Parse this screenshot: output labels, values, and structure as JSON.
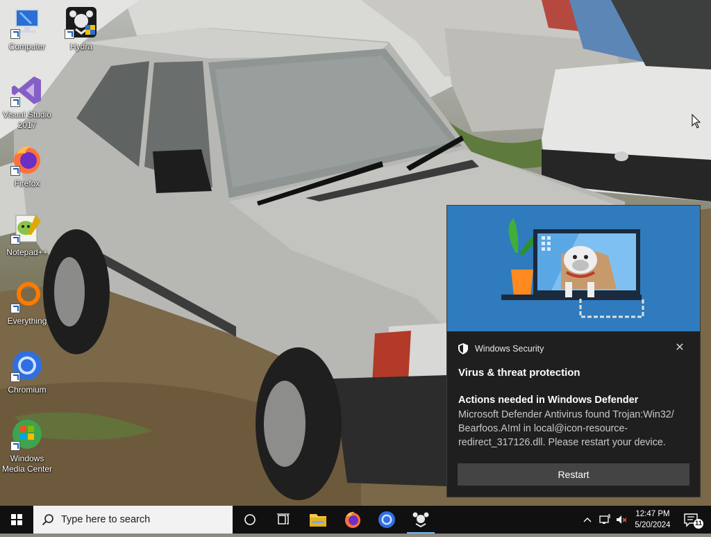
{
  "desktop": {
    "icons": [
      {
        "label": "Computer"
      },
      {
        "label": "Hydra"
      },
      {
        "label": "Visual Studio 2017"
      },
      {
        "label": "Firefox"
      },
      {
        "label": "Notepad++"
      },
      {
        "label": "Everything"
      },
      {
        "label": "Chromium"
      },
      {
        "label": "Windows Media Center"
      }
    ]
  },
  "toast": {
    "app_name": "Windows Security",
    "title": "Virus & threat protection",
    "subtitle": "Actions needed in Windows Defender",
    "body": "Microsoft Defender Antivirus found Trojan:Win32/ Bearfoos.A!ml in local@icon-resource-redirect_317126.dll. Please restart your device.",
    "button_label": "Restart",
    "close_glyph": "✕",
    "hero_color": "#2f7bbd"
  },
  "taskbar": {
    "search_placeholder": "Type here to search",
    "pinned": [
      "cortana-icon",
      "task-view-icon",
      "file-explorer-icon",
      "firefox-icon",
      "chromium-icon",
      "hydra-icon"
    ],
    "active_app": "hydra-icon",
    "clock_time": "12:47 PM",
    "clock_date": "5/20/2024",
    "notification_count": "11"
  }
}
